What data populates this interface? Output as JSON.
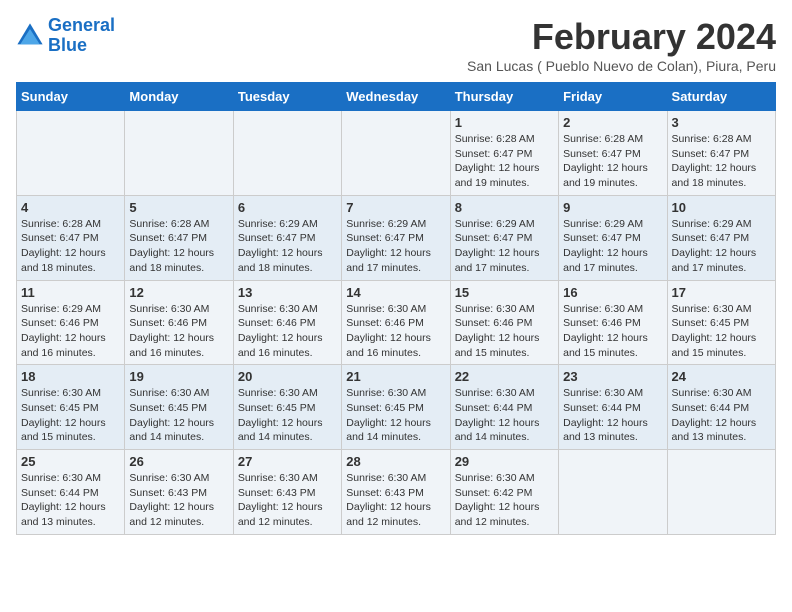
{
  "header": {
    "logo_line1": "General",
    "logo_line2": "Blue",
    "title": "February 2024",
    "subtitle": "San Lucas ( Pueblo Nuevo de Colan), Piura, Peru"
  },
  "days_of_week": [
    "Sunday",
    "Monday",
    "Tuesday",
    "Wednesday",
    "Thursday",
    "Friday",
    "Saturday"
  ],
  "weeks": [
    [
      {
        "day": "",
        "info": ""
      },
      {
        "day": "",
        "info": ""
      },
      {
        "day": "",
        "info": ""
      },
      {
        "day": "",
        "info": ""
      },
      {
        "day": "1",
        "info": "Sunrise: 6:28 AM\nSunset: 6:47 PM\nDaylight: 12 hours and 19 minutes."
      },
      {
        "day": "2",
        "info": "Sunrise: 6:28 AM\nSunset: 6:47 PM\nDaylight: 12 hours and 19 minutes."
      },
      {
        "day": "3",
        "info": "Sunrise: 6:28 AM\nSunset: 6:47 PM\nDaylight: 12 hours and 18 minutes."
      }
    ],
    [
      {
        "day": "4",
        "info": "Sunrise: 6:28 AM\nSunset: 6:47 PM\nDaylight: 12 hours and 18 minutes."
      },
      {
        "day": "5",
        "info": "Sunrise: 6:28 AM\nSunset: 6:47 PM\nDaylight: 12 hours and 18 minutes."
      },
      {
        "day": "6",
        "info": "Sunrise: 6:29 AM\nSunset: 6:47 PM\nDaylight: 12 hours and 18 minutes."
      },
      {
        "day": "7",
        "info": "Sunrise: 6:29 AM\nSunset: 6:47 PM\nDaylight: 12 hours and 17 minutes."
      },
      {
        "day": "8",
        "info": "Sunrise: 6:29 AM\nSunset: 6:47 PM\nDaylight: 12 hours and 17 minutes."
      },
      {
        "day": "9",
        "info": "Sunrise: 6:29 AM\nSunset: 6:47 PM\nDaylight: 12 hours and 17 minutes."
      },
      {
        "day": "10",
        "info": "Sunrise: 6:29 AM\nSunset: 6:47 PM\nDaylight: 12 hours and 17 minutes."
      }
    ],
    [
      {
        "day": "11",
        "info": "Sunrise: 6:29 AM\nSunset: 6:46 PM\nDaylight: 12 hours and 16 minutes."
      },
      {
        "day": "12",
        "info": "Sunrise: 6:30 AM\nSunset: 6:46 PM\nDaylight: 12 hours and 16 minutes."
      },
      {
        "day": "13",
        "info": "Sunrise: 6:30 AM\nSunset: 6:46 PM\nDaylight: 12 hours and 16 minutes."
      },
      {
        "day": "14",
        "info": "Sunrise: 6:30 AM\nSunset: 6:46 PM\nDaylight: 12 hours and 16 minutes."
      },
      {
        "day": "15",
        "info": "Sunrise: 6:30 AM\nSunset: 6:46 PM\nDaylight: 12 hours and 15 minutes."
      },
      {
        "day": "16",
        "info": "Sunrise: 6:30 AM\nSunset: 6:46 PM\nDaylight: 12 hours and 15 minutes."
      },
      {
        "day": "17",
        "info": "Sunrise: 6:30 AM\nSunset: 6:45 PM\nDaylight: 12 hours and 15 minutes."
      }
    ],
    [
      {
        "day": "18",
        "info": "Sunrise: 6:30 AM\nSunset: 6:45 PM\nDaylight: 12 hours and 15 minutes."
      },
      {
        "day": "19",
        "info": "Sunrise: 6:30 AM\nSunset: 6:45 PM\nDaylight: 12 hours and 14 minutes."
      },
      {
        "day": "20",
        "info": "Sunrise: 6:30 AM\nSunset: 6:45 PM\nDaylight: 12 hours and 14 minutes."
      },
      {
        "day": "21",
        "info": "Sunrise: 6:30 AM\nSunset: 6:45 PM\nDaylight: 12 hours and 14 minutes."
      },
      {
        "day": "22",
        "info": "Sunrise: 6:30 AM\nSunset: 6:44 PM\nDaylight: 12 hours and 14 minutes."
      },
      {
        "day": "23",
        "info": "Sunrise: 6:30 AM\nSunset: 6:44 PM\nDaylight: 12 hours and 13 minutes."
      },
      {
        "day": "24",
        "info": "Sunrise: 6:30 AM\nSunset: 6:44 PM\nDaylight: 12 hours and 13 minutes."
      }
    ],
    [
      {
        "day": "25",
        "info": "Sunrise: 6:30 AM\nSunset: 6:44 PM\nDaylight: 12 hours and 13 minutes."
      },
      {
        "day": "26",
        "info": "Sunrise: 6:30 AM\nSunset: 6:43 PM\nDaylight: 12 hours and 12 minutes."
      },
      {
        "day": "27",
        "info": "Sunrise: 6:30 AM\nSunset: 6:43 PM\nDaylight: 12 hours and 12 minutes."
      },
      {
        "day": "28",
        "info": "Sunrise: 6:30 AM\nSunset: 6:43 PM\nDaylight: 12 hours and 12 minutes."
      },
      {
        "day": "29",
        "info": "Sunrise: 6:30 AM\nSunset: 6:42 PM\nDaylight: 12 hours and 12 minutes."
      },
      {
        "day": "",
        "info": ""
      },
      {
        "day": "",
        "info": ""
      }
    ]
  ]
}
